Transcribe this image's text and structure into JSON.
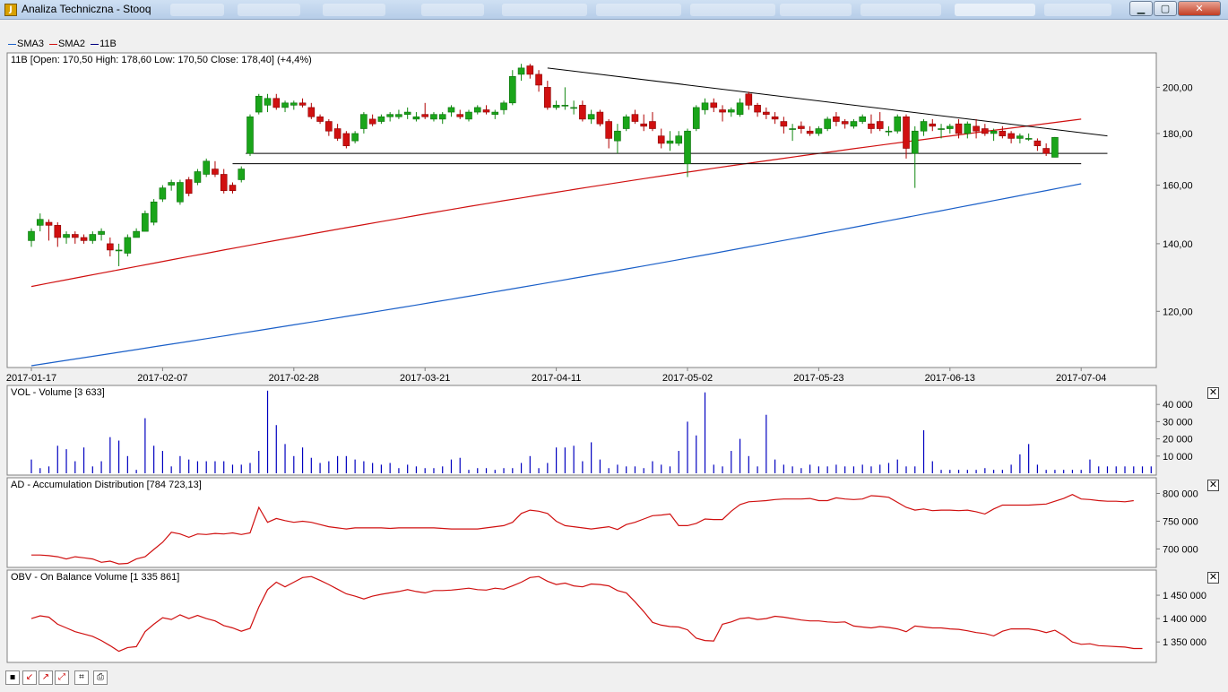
{
  "window": {
    "title": "Analiza Techniczna - Stooq",
    "min_label": "▁",
    "max_label": "▢",
    "close_label": "✕"
  },
  "legend": [
    {
      "name": "SMA3",
      "color": "#1a5fc8"
    },
    {
      "name": "SMA2",
      "color": "#d01010"
    },
    {
      "name": "11B",
      "color": "#000080"
    }
  ],
  "price_panel": {
    "title": "11B [Open: 170,50  High: 178,60  Low: 170,50  Close: 178,40] (+4,4%)"
  },
  "volume_panel": {
    "title": "VOL - Volume [3 633]"
  },
  "ad_panel": {
    "title": "AD - Accumulation Distribution [784 723,13]"
  },
  "obv_panel": {
    "title": "OBV - On Balance Volume [1 335 861]"
  },
  "close_glyph": "✕",
  "toolbar": [
    {
      "name": "save-icon",
      "glyph": "▪"
    },
    {
      "name": "zoom-in-icon",
      "glyph": "↙"
    },
    {
      "name": "zoom-out-icon",
      "glyph": "↗"
    },
    {
      "name": "zoom-area-icon",
      "glyph": "⤢"
    },
    {
      "name": "fit-icon",
      "glyph": "⌗"
    },
    {
      "name": "print-icon",
      "glyph": "⎙"
    }
  ],
  "chart_data": [
    {
      "type": "candlestick",
      "ticker": "11B",
      "x_tick_labels": [
        "2017-01-17",
        "2017-02-07",
        "2017-02-28",
        "2017-03-21",
        "2017-04-11",
        "2017-05-02",
        "2017-05-23",
        "2017-06-13",
        "2017-07-04"
      ],
      "y_tick_labels": [
        "200,00",
        "180,00",
        "160,00",
        "140,00",
        "120,00"
      ],
      "y_ticks": [
        200,
        180,
        160,
        140,
        120
      ],
      "y_scale": "log",
      "ylim": [
        106,
        215
      ],
      "grid": false,
      "legend_position": "top-left",
      "ohlc": [
        [
          141,
          145,
          139,
          144
        ],
        [
          146,
          150,
          144,
          148
        ],
        [
          147,
          148,
          141,
          146
        ],
        [
          146,
          147,
          139,
          142
        ],
        [
          142,
          144,
          140,
          143
        ],
        [
          143,
          144,
          140,
          142
        ],
        [
          142,
          143,
          140,
          141
        ],
        [
          141,
          144,
          140,
          143
        ],
        [
          143,
          145,
          141,
          144
        ],
        [
          140,
          142,
          136,
          138
        ],
        [
          138,
          140,
          133,
          138
        ],
        [
          137,
          143,
          136,
          142
        ],
        [
          142,
          145,
          142,
          144
        ],
        [
          144,
          151,
          144,
          150
        ],
        [
          147,
          155,
          146,
          154
        ],
        [
          155,
          160,
          154,
          159
        ],
        [
          160,
          162,
          158,
          161
        ],
        [
          154,
          162,
          153,
          161
        ],
        [
          162,
          163,
          156,
          157
        ],
        [
          161,
          166,
          160,
          165
        ],
        [
          164,
          170,
          163,
          169
        ],
        [
          166,
          169,
          163,
          164
        ],
        [
          164,
          166,
          157,
          158
        ],
        [
          160,
          161,
          157,
          158
        ],
        [
          162,
          167,
          161,
          166
        ],
        [
          172,
          188,
          171,
          187
        ],
        [
          189,
          197,
          188,
          196
        ],
        [
          192,
          197,
          189,
          195
        ],
        [
          195,
          197,
          190,
          191
        ],
        [
          191,
          194,
          189,
          193
        ],
        [
          192,
          194,
          190,
          193
        ],
        [
          193,
          195,
          191,
          192
        ],
        [
          191,
          193,
          186,
          187
        ],
        [
          187,
          188,
          184,
          185
        ],
        [
          185,
          186,
          179,
          181
        ],
        [
          182,
          184,
          177,
          178
        ],
        [
          180,
          181,
          174,
          175
        ],
        [
          177,
          181,
          176,
          180
        ],
        [
          182,
          189,
          180,
          188
        ],
        [
          186,
          188,
          183,
          184
        ],
        [
          185,
          188,
          184,
          187
        ],
        [
          187,
          189,
          185,
          188
        ],
        [
          187,
          190,
          186,
          188
        ],
        [
          188,
          191,
          186,
          189
        ],
        [
          186,
          189,
          185,
          187
        ],
        [
          188,
          193,
          186,
          187
        ],
        [
          186,
          189,
          185,
          188
        ],
        [
          186,
          189,
          184,
          188
        ],
        [
          189,
          192,
          187,
          191
        ],
        [
          188,
          190,
          186,
          187
        ],
        [
          186,
          190,
          185,
          189
        ],
        [
          189,
          192,
          188,
          191
        ],
        [
          190,
          192,
          188,
          189
        ],
        [
          188,
          190,
          186,
          189
        ],
        [
          190,
          194,
          188,
          193
        ],
        [
          193,
          208,
          192,
          205
        ],
        [
          206,
          211,
          203,
          209
        ],
        [
          210,
          211,
          204,
          206
        ],
        [
          206,
          208,
          198,
          201
        ],
        [
          200,
          203,
          190,
          191
        ],
        [
          191,
          194,
          190,
          192
        ],
        [
          192,
          200,
          190,
          192
        ],
        [
          191,
          194,
          188,
          191
        ],
        [
          192,
          194,
          185,
          186
        ],
        [
          186,
          190,
          184,
          188
        ],
        [
          189,
          190,
          183,
          184
        ],
        [
          185,
          186,
          174,
          178
        ],
        [
          177,
          184,
          172,
          181
        ],
        [
          182,
          188,
          181,
          187
        ],
        [
          188,
          190,
          184,
          185
        ],
        [
          184,
          188,
          181,
          183
        ],
        [
          185,
          189,
          181,
          182
        ],
        [
          179,
          182,
          174,
          176
        ],
        [
          176,
          181,
          173,
          177
        ],
        [
          176,
          181,
          175,
          179
        ],
        [
          168,
          182,
          163,
          181
        ],
        [
          182,
          192,
          181,
          191
        ],
        [
          190,
          195,
          188,
          193
        ],
        [
          193,
          195,
          189,
          191
        ],
        [
          190,
          192,
          185,
          189
        ],
        [
          189,
          191,
          187,
          190
        ],
        [
          188,
          195,
          187,
          193
        ],
        [
          197,
          198,
          190,
          192
        ],
        [
          192,
          193,
          187,
          189
        ],
        [
          189,
          191,
          186,
          188
        ],
        [
          187,
          189,
          184,
          186
        ],
        [
          185,
          187,
          180,
          183
        ],
        [
          182,
          184,
          177,
          182
        ],
        [
          183,
          185,
          180,
          182
        ],
        [
          181,
          183,
          179,
          180
        ],
        [
          180,
          183,
          179,
          182
        ],
        [
          182,
          187,
          181,
          186
        ],
        [
          187,
          189,
          183,
          185
        ],
        [
          185,
          186,
          182,
          184
        ],
        [
          183,
          186,
          182,
          185
        ],
        [
          185,
          188,
          184,
          187
        ],
        [
          184,
          188,
          180,
          182
        ],
        [
          185,
          189,
          181,
          182
        ],
        [
          181,
          183,
          179,
          181
        ],
        [
          181,
          188,
          180,
          187
        ],
        [
          187,
          188,
          170,
          174
        ],
        [
          172,
          183,
          159,
          181
        ],
        [
          181,
          186,
          179,
          185
        ],
        [
          184,
          186,
          181,
          183
        ],
        [
          182,
          184,
          178,
          182
        ],
        [
          182,
          184,
          180,
          183
        ],
        [
          184,
          186,
          178,
          180
        ],
        [
          180,
          185,
          178,
          184
        ],
        [
          183,
          186,
          178,
          181
        ],
        [
          182,
          184,
          179,
          180
        ],
        [
          180,
          182,
          177,
          181
        ],
        [
          181,
          183,
          178,
          179
        ],
        [
          180,
          181,
          176,
          178
        ],
        [
          178,
          180,
          176,
          179
        ],
        [
          178,
          180,
          177,
          178
        ],
        [
          177,
          178,
          173,
          175
        ],
        [
          174,
          176,
          171,
          172
        ],
        [
          170.5,
          178.6,
          170.5,
          178.4
        ]
      ],
      "sma3": [
        [
          0,
          106
        ],
        [
          120,
          160.5
        ]
      ],
      "sma2": [
        [
          0,
          127
        ],
        [
          120,
          186
        ]
      ],
      "trendlines": [
        {
          "from": [
            59,
            209
          ],
          "to": [
            123,
            179
          ]
        },
        {
          "from": [
            23,
            168
          ],
          "to": [
            120,
            168
          ]
        },
        {
          "from": [
            24.5,
            172
          ],
          "to": [
            123,
            172
          ]
        }
      ]
    },
    {
      "type": "bar",
      "name": "VOL - Volume",
      "y_tick_labels": [
        "40 000",
        "30 000",
        "20 000",
        "10 000"
      ],
      "y_ticks": [
        40000,
        30000,
        20000,
        10000
      ],
      "ylim": [
        0,
        50000
      ],
      "color": "#0000c0",
      "values": [
        8000,
        3000,
        4000,
        16000,
        14000,
        7000,
        15000,
        4000,
        7000,
        21000,
        19000,
        10000,
        2000,
        32000,
        16000,
        13000,
        4000,
        10000,
        8000,
        7000,
        7000,
        7000,
        7000,
        5000,
        5000,
        6000,
        13000,
        48000,
        28000,
        17000,
        10000,
        15000,
        9000,
        6000,
        7000,
        10000,
        10000,
        8000,
        7000,
        6000,
        5000,
        6000,
        3000,
        5000,
        4000,
        3000,
        3000,
        4000,
        8000,
        9000,
        2000,
        3000,
        3000,
        2000,
        3000,
        3000,
        6000,
        10000,
        3000,
        6000,
        15000,
        15000,
        16000,
        7000,
        18000,
        8000,
        3000,
        5000,
        4000,
        4000,
        3000,
        7000,
        5000,
        4000,
        13000,
        30000,
        22000,
        47000,
        5000,
        4000,
        13000,
        20000,
        10000,
        4000,
        34000,
        8000,
        5000,
        4000,
        3000,
        5000,
        4000,
        4000,
        5000,
        4000,
        4000,
        5000,
        4000,
        5000,
        6000,
        8000,
        4000,
        4000,
        25000,
        7000,
        2000,
        2000,
        2000,
        2000,
        2000,
        3000,
        2000,
        2000,
        5000,
        11000,
        17000,
        5000,
        2000,
        2000,
        2000,
        2000,
        2000,
        8000,
        4000,
        4000,
        4000,
        4000,
        4000,
        4000,
        4000
      ],
      "last_value": 3633
    },
    {
      "type": "line",
      "name": "AD - Accumulation Distribution",
      "y_tick_labels": [
        "800 000",
        "750 000",
        "700 000"
      ],
      "y_ticks": [
        800000,
        750000,
        700000
      ],
      "ylim": [
        670000,
        825000
      ],
      "color": "#d01010",
      "values": [
        689000,
        689000,
        688000,
        686000,
        682000,
        686000,
        684000,
        682000,
        676000,
        678000,
        673000,
        674000,
        682000,
        686000,
        699000,
        712000,
        730000,
        727000,
        721000,
        727000,
        726000,
        728000,
        727000,
        729000,
        726000,
        729000,
        775000,
        748000,
        755000,
        751000,
        748000,
        750000,
        748000,
        744000,
        740000,
        738000,
        736000,
        738000,
        738000,
        738000,
        738000,
        737000,
        738000,
        738000,
        738000,
        738000,
        738000,
        737000,
        736000,
        736000,
        736000,
        736000,
        738000,
        740000,
        742000,
        748000,
        764000,
        770000,
        768000,
        764000,
        750000,
        742000,
        740000,
        738000,
        736000,
        738000,
        740000,
        735000,
        744000,
        748000,
        754000,
        760000,
        761000,
        763000,
        742000,
        742000,
        746000,
        754000,
        753000,
        753000,
        768000,
        780000,
        785000,
        786000,
        787000,
        789000,
        790000,
        790000,
        790000,
        791000,
        787000,
        787000,
        792000,
        790000,
        789000,
        790000,
        796000,
        795000,
        793000,
        784000,
        775000,
        770000,
        772000,
        769000,
        770000,
        770000,
        769000,
        770000,
        767000,
        763000,
        772000,
        779000,
        779000,
        779000,
        779000,
        780000,
        781000,
        786000,
        791000,
        798000,
        790000,
        789000,
        787000,
        786000,
        786000,
        785000,
        787000
      ],
      "last_value": 784723.13
    },
    {
      "type": "line",
      "name": "OBV - On Balance Volume",
      "y_tick_labels": [
        "1 450 000",
        "1 400 000",
        "1 350 000"
      ],
      "y_ticks": [
        1450000,
        1400000,
        1350000
      ],
      "ylim": [
        1310000,
        1500000
      ],
      "color": "#d01010",
      "values": [
        1400000,
        1406000,
        1403000,
        1388000,
        1380000,
        1372000,
        1367000,
        1362000,
        1353000,
        1342000,
        1330000,
        1338000,
        1340000,
        1372000,
        1388000,
        1402000,
        1398000,
        1408000,
        1400000,
        1407000,
        1400000,
        1395000,
        1385000,
        1380000,
        1373000,
        1379000,
        1425000,
        1462000,
        1478000,
        1468000,
        1478000,
        1488000,
        1490000,
        1482000,
        1473000,
        1463000,
        1453000,
        1448000,
        1442000,
        1448000,
        1452000,
        1455000,
        1458000,
        1462000,
        1458000,
        1455000,
        1460000,
        1460000,
        1461000,
        1463000,
        1465000,
        1462000,
        1461000,
        1465000,
        1463000,
        1470000,
        1478000,
        1488000,
        1490000,
        1480000,
        1473000,
        1476000,
        1470000,
        1468000,
        1474000,
        1473000,
        1470000,
        1460000,
        1455000,
        1436000,
        1415000,
        1392000,
        1386000,
        1383000,
        1382000,
        1376000,
        1358000,
        1353000,
        1352000,
        1388000,
        1393000,
        1400000,
        1402000,
        1398000,
        1400000,
        1405000,
        1403000,
        1400000,
        1397000,
        1395000,
        1395000,
        1393000,
        1392000,
        1393000,
        1384000,
        1382000,
        1380000,
        1383000,
        1381000,
        1378000,
        1372000,
        1384000,
        1382000,
        1380000,
        1380000,
        1378000,
        1377000,
        1374000,
        1370000,
        1368000,
        1363000,
        1373000,
        1378000,
        1378000,
        1378000,
        1375000,
        1370000,
        1375000,
        1364000,
        1350000,
        1345000,
        1346000,
        1342000,
        1341000,
        1340000,
        1339000,
        1336000,
        1335861
      ],
      "last_value": 1335861
    }
  ]
}
